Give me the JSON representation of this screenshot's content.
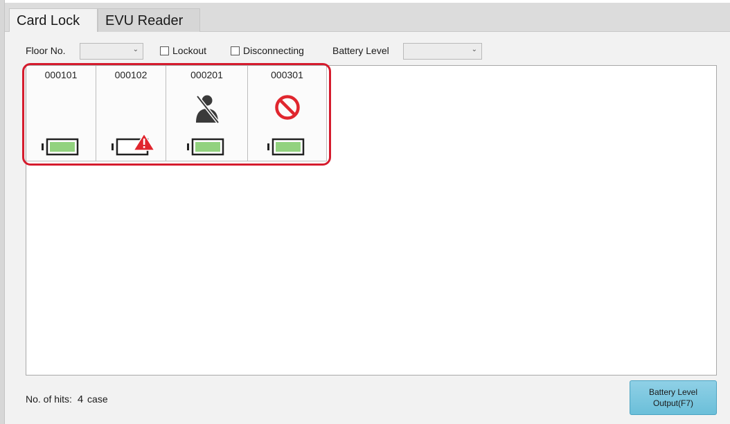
{
  "tabs": [
    {
      "label": "Card Lock"
    },
    {
      "label": "EVU Reader"
    }
  ],
  "filters": {
    "floor_label": "Floor No.",
    "floor_value": "",
    "lockout_label": "Lockout",
    "lockout_checked": false,
    "disconnecting_label": "Disconnecting",
    "disconnecting_checked": false,
    "battery_label": "Battery Level",
    "battery_value": ""
  },
  "locks": [
    {
      "number": "000101",
      "status_icon": "none",
      "battery_icon": "battery-ok-icon",
      "battery_level": 1.0
    },
    {
      "number": "000102",
      "status_icon": "none",
      "battery_icon": "battery-warning-icon",
      "battery_level": 0.0
    },
    {
      "number": "000201",
      "status_icon": "person-disconnected-icon",
      "battery_icon": "battery-ok-icon",
      "battery_level": 1.0
    },
    {
      "number": "000301",
      "status_icon": "prohibited-icon",
      "battery_icon": "battery-ok-icon",
      "battery_level": 1.0
    }
  ],
  "footer": {
    "hits_label": "No. of hits:",
    "hits_count": "4",
    "hits_unit": "case",
    "export_line1": "Battery Level",
    "export_line2": "Output(F7)"
  },
  "colors": {
    "highlight": "#d51b2d",
    "battery_fill": "#92d27f",
    "warning": "#e0262e",
    "prohibited": "#e0262e"
  }
}
